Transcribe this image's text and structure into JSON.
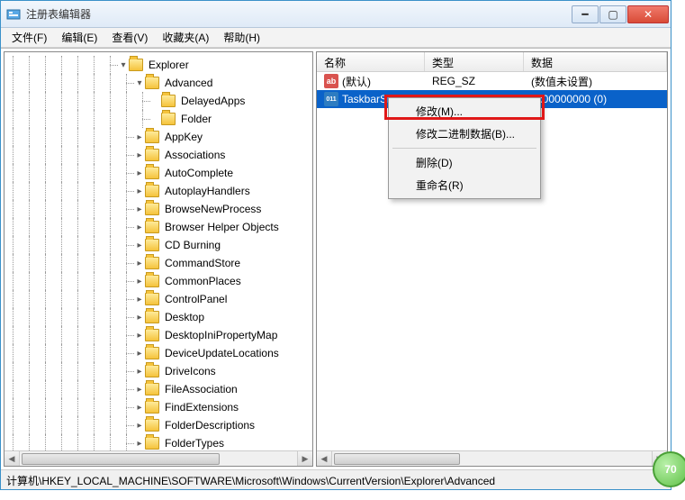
{
  "window": {
    "title": "注册表编辑器"
  },
  "menubar": {
    "file": "文件(F)",
    "edit": "编辑(E)",
    "view": "查看(V)",
    "favorites": "收藏夹(A)",
    "help": "帮助(H)"
  },
  "tree": {
    "items": [
      {
        "indent": 7,
        "toggle": "▾",
        "label": "Explorer"
      },
      {
        "indent": 8,
        "toggle": "▾",
        "label": "Advanced"
      },
      {
        "indent": 9,
        "toggle": "",
        "label": "DelayedApps"
      },
      {
        "indent": 9,
        "toggle": "",
        "label": "Folder"
      },
      {
        "indent": 8,
        "toggle": "▸",
        "label": "AppKey"
      },
      {
        "indent": 8,
        "toggle": "▸",
        "label": "Associations"
      },
      {
        "indent": 8,
        "toggle": "▸",
        "label": "AutoComplete"
      },
      {
        "indent": 8,
        "toggle": "▸",
        "label": "AutoplayHandlers"
      },
      {
        "indent": 8,
        "toggle": "▸",
        "label": "BrowseNewProcess"
      },
      {
        "indent": 8,
        "toggle": "▸",
        "label": "Browser Helper Objects"
      },
      {
        "indent": 8,
        "toggle": "▸",
        "label": "CD Burning"
      },
      {
        "indent": 8,
        "toggle": "▸",
        "label": "CommandStore"
      },
      {
        "indent": 8,
        "toggle": "▸",
        "label": "CommonPlaces"
      },
      {
        "indent": 8,
        "toggle": "▸",
        "label": "ControlPanel"
      },
      {
        "indent": 8,
        "toggle": "▸",
        "label": "Desktop"
      },
      {
        "indent": 8,
        "toggle": "▸",
        "label": "DesktopIniPropertyMap"
      },
      {
        "indent": 8,
        "toggle": "▸",
        "label": "DeviceUpdateLocations"
      },
      {
        "indent": 8,
        "toggle": "▸",
        "label": "DriveIcons"
      },
      {
        "indent": 8,
        "toggle": "▸",
        "label": "FileAssociation"
      },
      {
        "indent": 8,
        "toggle": "▸",
        "label": "FindExtensions"
      },
      {
        "indent": 8,
        "toggle": "▸",
        "label": "FolderDescriptions"
      },
      {
        "indent": 8,
        "toggle": "▸",
        "label": "FolderTypes"
      }
    ]
  },
  "list": {
    "columns": {
      "name": "名称",
      "type": "类型",
      "data": "数据"
    },
    "rows": [
      {
        "icon": "str",
        "name": "(默认)",
        "type": "REG_SZ",
        "data": "(数值未设置)",
        "selected": false
      },
      {
        "icon": "dw",
        "name": "TaskbarSi",
        "type": "",
        "data": "0x00000000 (0)",
        "selected": true
      }
    ]
  },
  "context_menu": {
    "modify": "修改(M)...",
    "modify_binary": "修改二进制数据(B)...",
    "delete": "删除(D)",
    "rename": "重命名(R)"
  },
  "statusbar": {
    "path": "计算机\\HKEY_LOCAL_MACHINE\\SOFTWARE\\Microsoft\\Windows\\CurrentVersion\\Explorer\\Advanced"
  },
  "badge": {
    "value": "70"
  }
}
